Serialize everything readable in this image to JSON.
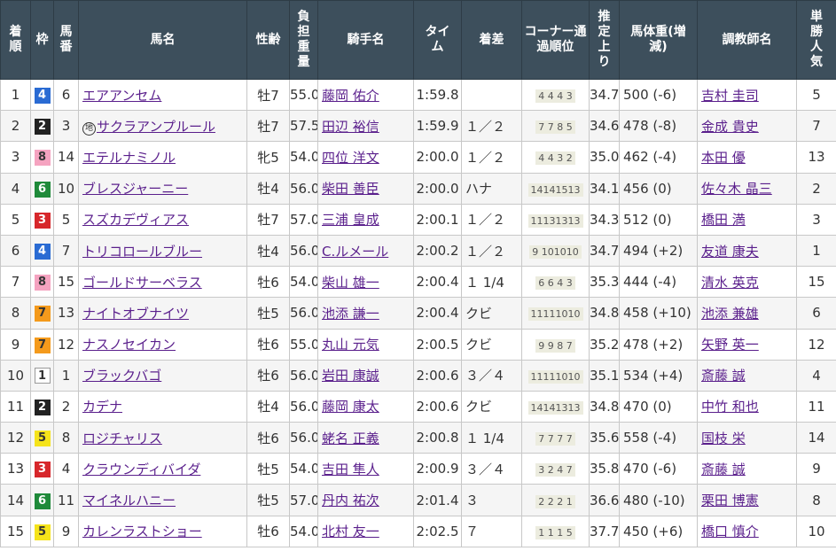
{
  "headers": {
    "rank": "着順",
    "waku": "枠",
    "num": "馬番",
    "horse": "馬名",
    "sex_age": "性齢",
    "weight": "負担重量",
    "jockey": "騎手名",
    "time": "タイム",
    "margin": "着差",
    "corner": "コーナー通過順位",
    "last": "推定上り",
    "body": "馬体重(増減)",
    "trainer": "調教師名",
    "pop": "単勝人気"
  },
  "local_mark": "地",
  "rows": [
    {
      "rank": "1",
      "waku": "4",
      "num": "6",
      "horse": "エアアンセム",
      "local": false,
      "sex_age": "牡7",
      "weight": "55.0",
      "jockey": "藤岡 佑介",
      "time": "1:59.8",
      "margin": "",
      "corner": "4 4 4 3",
      "last": "34.7",
      "body": "500 (-6)",
      "trainer": "吉村 圭司",
      "pop": "5"
    },
    {
      "rank": "2",
      "waku": "2",
      "num": "3",
      "horse": "サクラアンプルール",
      "local": true,
      "sex_age": "牡7",
      "weight": "57.5",
      "jockey": "田辺 裕信",
      "time": "1:59.9",
      "margin": "１／２",
      "corner": "7 7 8 5",
      "last": "34.6",
      "body": "478 (-8)",
      "trainer": "金成 貴史",
      "pop": "7"
    },
    {
      "rank": "3",
      "waku": "8",
      "num": "14",
      "horse": "エテルナミノル",
      "local": false,
      "sex_age": "牝5",
      "weight": "54.0",
      "jockey": "四位 洋文",
      "time": "2:00.0",
      "margin": "１／２",
      "corner": "4 4 3 2",
      "last": "35.0",
      "body": "462 (-4)",
      "trainer": "本田 優",
      "pop": "13"
    },
    {
      "rank": "4",
      "waku": "6",
      "num": "10",
      "horse": "ブレスジャーニー",
      "local": false,
      "sex_age": "牡4",
      "weight": "56.0",
      "jockey": "柴田 善臣",
      "time": "2:00.0",
      "margin": "ハナ",
      "corner": "14141513",
      "last": "34.1",
      "body": "456 (0)",
      "trainer": "佐々木 晶三",
      "pop": "2"
    },
    {
      "rank": "5",
      "waku": "3",
      "num": "5",
      "horse": "スズカデヴィアス",
      "local": false,
      "sex_age": "牡7",
      "weight": "57.0",
      "jockey": "三浦 皇成",
      "time": "2:00.1",
      "margin": "１／２",
      "corner": "11131313",
      "last": "34.3",
      "body": "512 (0)",
      "trainer": "橋田 満",
      "pop": "3"
    },
    {
      "rank": "6",
      "waku": "4",
      "num": "7",
      "horse": "トリコロールブルー",
      "local": false,
      "sex_age": "牡4",
      "weight": "56.0",
      "jockey": "C.ルメール",
      "time": "2:00.2",
      "margin": "１／２",
      "corner": "9 101010",
      "last": "34.7",
      "body": "494 (+2)",
      "trainer": "友道 康夫",
      "pop": "1"
    },
    {
      "rank": "7",
      "waku": "8",
      "num": "15",
      "horse": "ゴールドサーベラス",
      "local": false,
      "sex_age": "牡6",
      "weight": "54.0",
      "jockey": "柴山 雄一",
      "time": "2:00.4",
      "margin": "１ 1/4",
      "corner": "6 6 4 3",
      "last": "35.3",
      "body": "444 (-4)",
      "trainer": "清水 英克",
      "pop": "15"
    },
    {
      "rank": "8",
      "waku": "7",
      "num": "13",
      "horse": "ナイトオブナイツ",
      "local": false,
      "sex_age": "牡5",
      "weight": "56.0",
      "jockey": "池添 謙一",
      "time": "2:00.4",
      "margin": "クビ",
      "corner": "11111010",
      "last": "34.8",
      "body": "458 (+10)",
      "trainer": "池添 兼雄",
      "pop": "6"
    },
    {
      "rank": "9",
      "waku": "7",
      "num": "12",
      "horse": "ナスノセイカン",
      "local": false,
      "sex_age": "牡6",
      "weight": "55.0",
      "jockey": "丸山 元気",
      "time": "2:00.5",
      "margin": "クビ",
      "corner": "9 9 8 7",
      "last": "35.2",
      "body": "478 (+2)",
      "trainer": "矢野 英一",
      "pop": "12"
    },
    {
      "rank": "10",
      "waku": "1",
      "num": "1",
      "horse": "ブラックバゴ",
      "local": false,
      "sex_age": "牡6",
      "weight": "56.0",
      "jockey": "岩田 康誠",
      "time": "2:00.6",
      "margin": "３／４",
      "corner": "11111010",
      "last": "35.1",
      "body": "534 (+4)",
      "trainer": "斎藤 誠",
      "pop": "4"
    },
    {
      "rank": "11",
      "waku": "2",
      "num": "2",
      "horse": "カデナ",
      "local": false,
      "sex_age": "牡4",
      "weight": "56.0",
      "jockey": "藤岡 康太",
      "time": "2:00.6",
      "margin": "クビ",
      "corner": "14141313",
      "last": "34.8",
      "body": "470 (0)",
      "trainer": "中竹 和也",
      "pop": "11"
    },
    {
      "rank": "12",
      "waku": "5",
      "num": "8",
      "horse": "ロジチャリス",
      "local": false,
      "sex_age": "牡6",
      "weight": "56.0",
      "jockey": "蛯名 正義",
      "time": "2:00.8",
      "margin": "１ 1/4",
      "corner": "7 7 7 7",
      "last": "35.6",
      "body": "558 (-4)",
      "trainer": "国枝 栄",
      "pop": "14"
    },
    {
      "rank": "13",
      "waku": "3",
      "num": "4",
      "horse": "クラウンディバイダ",
      "local": false,
      "sex_age": "牡5",
      "weight": "54.0",
      "jockey": "吉田 隼人",
      "time": "2:00.9",
      "margin": "３／４",
      "corner": "3 2 4 7",
      "last": "35.8",
      "body": "470 (-6)",
      "trainer": "斎藤 誠",
      "pop": "9"
    },
    {
      "rank": "14",
      "waku": "6",
      "num": "11",
      "horse": "マイネルハニー",
      "local": false,
      "sex_age": "牡5",
      "weight": "57.0",
      "jockey": "丹内 祐次",
      "time": "2:01.4",
      "margin": "３",
      "corner": "2 2 2 1",
      "last": "36.6",
      "body": "480 (-10)",
      "trainer": "栗田 博憲",
      "pop": "8"
    },
    {
      "rank": "15",
      "waku": "5",
      "num": "9",
      "horse": "カレンラストショー",
      "local": false,
      "sex_age": "牡6",
      "weight": "54.0",
      "jockey": "北村 友一",
      "time": "2:02.5",
      "margin": "７",
      "corner": "1 1 1 5",
      "last": "37.7",
      "body": "450 (+6)",
      "trainer": "橋口 慎介",
      "pop": "10"
    }
  ]
}
